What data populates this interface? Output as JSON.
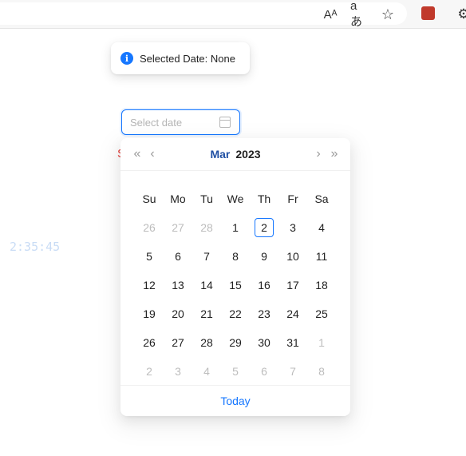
{
  "browser": {
    "icons": [
      "read-aloud-icon",
      "translate-icon",
      "favorites-icon",
      "extension-icon",
      "extensions-puzzle-icon"
    ],
    "read_aloud_glyph": "Aᴬ",
    "translate_glyph": "aあ",
    "favorites_glyph": "☆",
    "puzzle_glyph": "⚙"
  },
  "toast": {
    "text": "Selected Date: None",
    "icon": "info-icon",
    "icon_glyph": "i"
  },
  "date_input": {
    "placeholder": "Select date",
    "value": ""
  },
  "background": {
    "red_fragment": "S",
    "clock_fragment": "2:35:45"
  },
  "calendar": {
    "month": "Mar",
    "year": "2023",
    "nav": {
      "super_prev": "«",
      "prev": "‹",
      "next": "›",
      "super_next": "»"
    },
    "weekdays": [
      "Su",
      "Mo",
      "Tu",
      "We",
      "Th",
      "Fr",
      "Sa"
    ],
    "weeks": [
      [
        "26",
        "27",
        "28",
        "1",
        "2",
        "3",
        "4"
      ],
      [
        "5",
        "6",
        "7",
        "8",
        "9",
        "10",
        "11"
      ],
      [
        "12",
        "13",
        "14",
        "15",
        "16",
        "17",
        "18"
      ],
      [
        "19",
        "20",
        "21",
        "22",
        "23",
        "24",
        "25"
      ],
      [
        "26",
        "27",
        "28",
        "29",
        "30",
        "31",
        "1"
      ],
      [
        "2",
        "3",
        "4",
        "5",
        "6",
        "7",
        "8"
      ]
    ],
    "out_of_month": [
      [
        0,
        0
      ],
      [
        0,
        1
      ],
      [
        0,
        2
      ],
      [
        4,
        6
      ],
      [
        5,
        0
      ],
      [
        5,
        1
      ],
      [
        5,
        2
      ],
      [
        5,
        3
      ],
      [
        5,
        4
      ],
      [
        5,
        5
      ],
      [
        5,
        6
      ]
    ],
    "today": [
      0,
      4
    ],
    "footer_today": "Today"
  },
  "colors": {
    "accent": "#1677ff",
    "month_title": "#1f4fa3",
    "out_of_month_text": "#bdbdbd"
  }
}
